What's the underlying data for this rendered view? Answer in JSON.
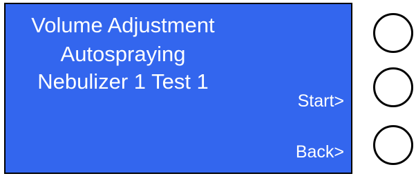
{
  "display": {
    "background_color": "#3366ee",
    "text_color": "#ffffff",
    "lines": [
      "Volume Adjustment",
      "Autospraying",
      "Nebulizer 1 Test 1"
    ],
    "softkeys": {
      "start_label": "Start>",
      "back_label": "Back>"
    }
  },
  "hardware_buttons": [
    {
      "name": "top",
      "label": ""
    },
    {
      "name": "middle",
      "label": ""
    },
    {
      "name": "bottom",
      "label": ""
    }
  ]
}
